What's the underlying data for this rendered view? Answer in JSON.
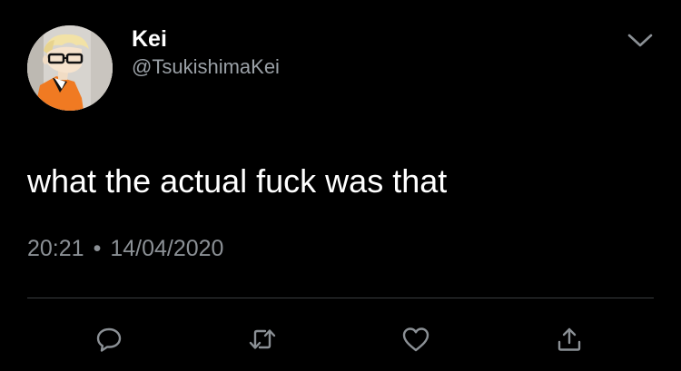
{
  "user": {
    "display_name": "Kei",
    "handle": "@TsukishimaKei",
    "avatar_icon": "profile-avatar"
  },
  "tweet": {
    "text": "what the actual fuck was that",
    "time": "20:21",
    "separator": "•",
    "date": "14/04/2020"
  },
  "actions": {
    "reply_icon": "reply-icon",
    "retweet_icon": "retweet-icon",
    "like_icon": "heart-icon",
    "share_icon": "share-icon",
    "more_icon": "chevron-down-icon"
  },
  "colors": {
    "background": "#000000",
    "primary_text": "#ffffff",
    "secondary_text": "#8b9095",
    "icon": "#8b9095",
    "divider": "#3a3d40"
  }
}
